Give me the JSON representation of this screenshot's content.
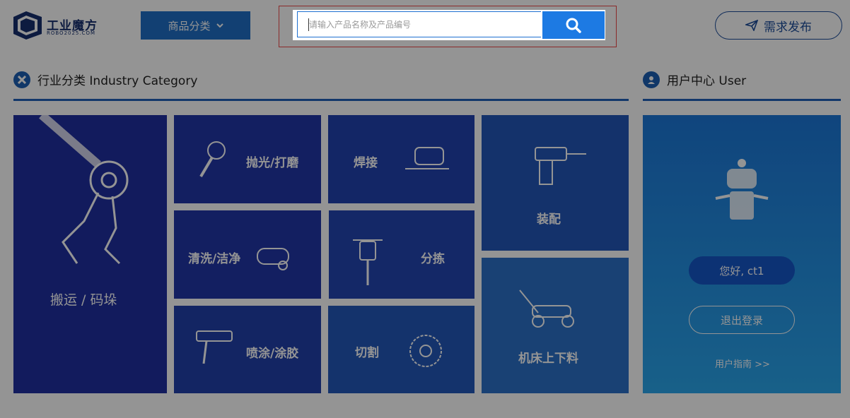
{
  "header": {
    "logo_text": "工业魔方",
    "logo_sub": "ROBO2025.COM",
    "category_button": "商品分类",
    "search_placeholder": "请输入产品名称及产品编号",
    "post_button": "需求发布"
  },
  "industry": {
    "title": "行业分类 Industry Category",
    "tiles": [
      {
        "label": "搬运 / 码垛"
      },
      {
        "label": "抛光/打磨"
      },
      {
        "label": "焊接"
      },
      {
        "label": "装配"
      },
      {
        "label": "清洗/洁净"
      },
      {
        "label": "分拣"
      },
      {
        "label": "喷涂/涂胶"
      },
      {
        "label": "切割"
      },
      {
        "label": "机床上下料"
      }
    ]
  },
  "user": {
    "title": "用户中心 User",
    "hello": "您好, ct1",
    "logout": "退出登录",
    "guide": "用户指南 >>"
  },
  "colors": {
    "accent": "#1d7ae3",
    "dark": "#1f3ea1",
    "overlay": "rgba(0,0,0,0.42)"
  }
}
